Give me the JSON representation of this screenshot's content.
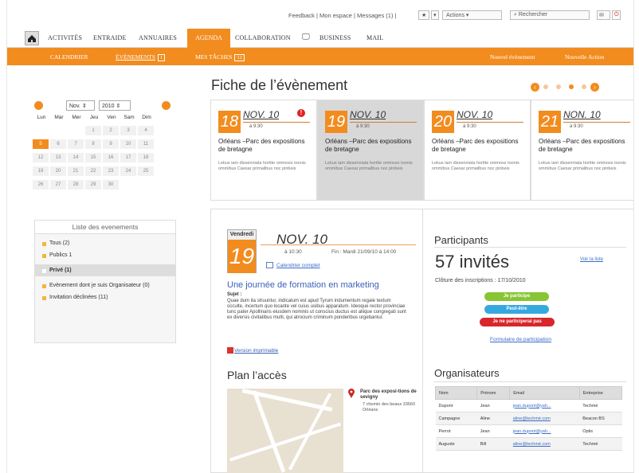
{
  "top": {
    "links": "Feedback | Mon espace | Messages (1) |",
    "actions": "Actions",
    "search": "Rechercher"
  },
  "nav": {
    "items": [
      "ACTIVITÉS",
      "ENTRAIDE",
      "ANNUAIRES",
      "AGENDA",
      "COLLABORATION",
      "BUSINESS",
      "MAIL"
    ]
  },
  "subnav": {
    "calendar": "CALENDRIER",
    "events": "ÉVÈNEMENTS",
    "events_count": "1",
    "tasks": "MES TÂCHES",
    "tasks_count": "12",
    "new_event": "Nouvel évènement",
    "new_action": "Nouvelle Action"
  },
  "calendar": {
    "month": "Nov.",
    "year": "2010",
    "days": [
      "Lun",
      "Mar",
      "Mer",
      "Jeu",
      "Ven",
      "Sam",
      "Dim"
    ],
    "rows": [
      [
        "",
        "",
        "",
        "1",
        "2",
        "3",
        "4"
      ],
      [
        "5",
        "6",
        "7",
        "8",
        "9",
        "10",
        "11"
      ],
      [
        "12",
        "13",
        "14",
        "15",
        "16",
        "17",
        "18"
      ],
      [
        "19",
        "20",
        "21",
        "22",
        "23",
        "24",
        "25"
      ],
      [
        "26",
        "27",
        "28",
        "29",
        "30",
        "",
        ""
      ]
    ]
  },
  "events": {
    "header": "Liste des evenements",
    "items": [
      {
        "label": "Tous",
        "count": "(2)"
      },
      {
        "label": "Publics",
        "count": "1"
      },
      {
        "label": "Privé",
        "count": "(1)"
      },
      {
        "label": "Evènement dont je suis Organisateur",
        "count": "(0)"
      },
      {
        "label": "Invitation déclinées",
        "count": "(11)"
      }
    ]
  },
  "page_title": "Fiche de l’évènement",
  "cards": [
    {
      "day": "18",
      "month": "NOV. 10",
      "time": "à 9:30",
      "title": "Orléans –Parc des expositions de bretagne",
      "desc": "Lekus iam dissenniata horitte ommoss toonis ommibus Caesar primailbus noc pinbeis"
    },
    {
      "day": "19",
      "month": "NOV. 10",
      "time": "à 9:30",
      "title": "Orléans –Parc des expositions de bretagne",
      "desc": "Lekus iam dissenniata horitte ommoss toonis ommibus Caesar primailbus noc pinbeis"
    },
    {
      "day": "20",
      "month": "NOV. 10",
      "time": "à 9:30",
      "title": "Orléans –Parc des expositions de bretagne",
      "desc": "Lekus iam dissenniata horitte ommoss toonis ommibus Caesar primailbus noc pinbeis"
    },
    {
      "day": "21",
      "month": "NON. 10",
      "time": "à 9:30",
      "title": "Orléans –Parc des expositions de bretagne",
      "desc": "Lekus iam dissenniata horitte ommoss toonis ommibus Caesar primailbus noc pinbeis"
    }
  ],
  "event": {
    "weekday": "Vendredi",
    "month": "NOV. 10",
    "day": "19",
    "time": "à 10:30",
    "fin": "Fin : Mardi 21/09/10 à 14:00",
    "calendar_link": "Calendrier complet",
    "headline": "Une journée de formation en marketing",
    "sujet": "Sujet :",
    "text": "Quae dum ita struuntur, indicatum est apud Tyrum indumentum regale textum occulte, incertum quo locante vel cuius usibus apparatum. Ideoque rector provinciae tunc pater Apollinaris eiusdem nominis ut conscius ductus est aliique congregati sunt ex diversis civitatibus multi, qui atrocium criminum ponderibus urgebantur.",
    "print": "Version imprimable",
    "plan": "Plan l’accès",
    "address_title": "Parc des exposi-tions de sevigny",
    "address": "7 chemin des beaux 33560 Orléans"
  },
  "participants": {
    "title": "Participants",
    "count": "57 invités",
    "see": "Voir la liste",
    "closing": "Clôture des inscriptions : 17/10/2010",
    "participate": "Je participe",
    "maybe": "Peut-être",
    "decline": "Je ne participerai pas",
    "form": "Formulaire de participation"
  },
  "organisers": {
    "title": "Organisateurs",
    "headers": [
      "Nom",
      "Prénom",
      "Email",
      "Entreprise"
    ],
    "rows": [
      [
        "Dupont",
        "Jean",
        "jean.dupont@yah...",
        "Techmé"
      ],
      [
        "Campagne",
        "Aline",
        "aline@techmé.com",
        "Beacon BS"
      ],
      [
        "Perrot",
        "Jean",
        "jean.dupont@yah...",
        "Optis"
      ],
      [
        "Auguste",
        "Bill",
        "aline@techmé.com",
        "Techmé"
      ]
    ]
  }
}
